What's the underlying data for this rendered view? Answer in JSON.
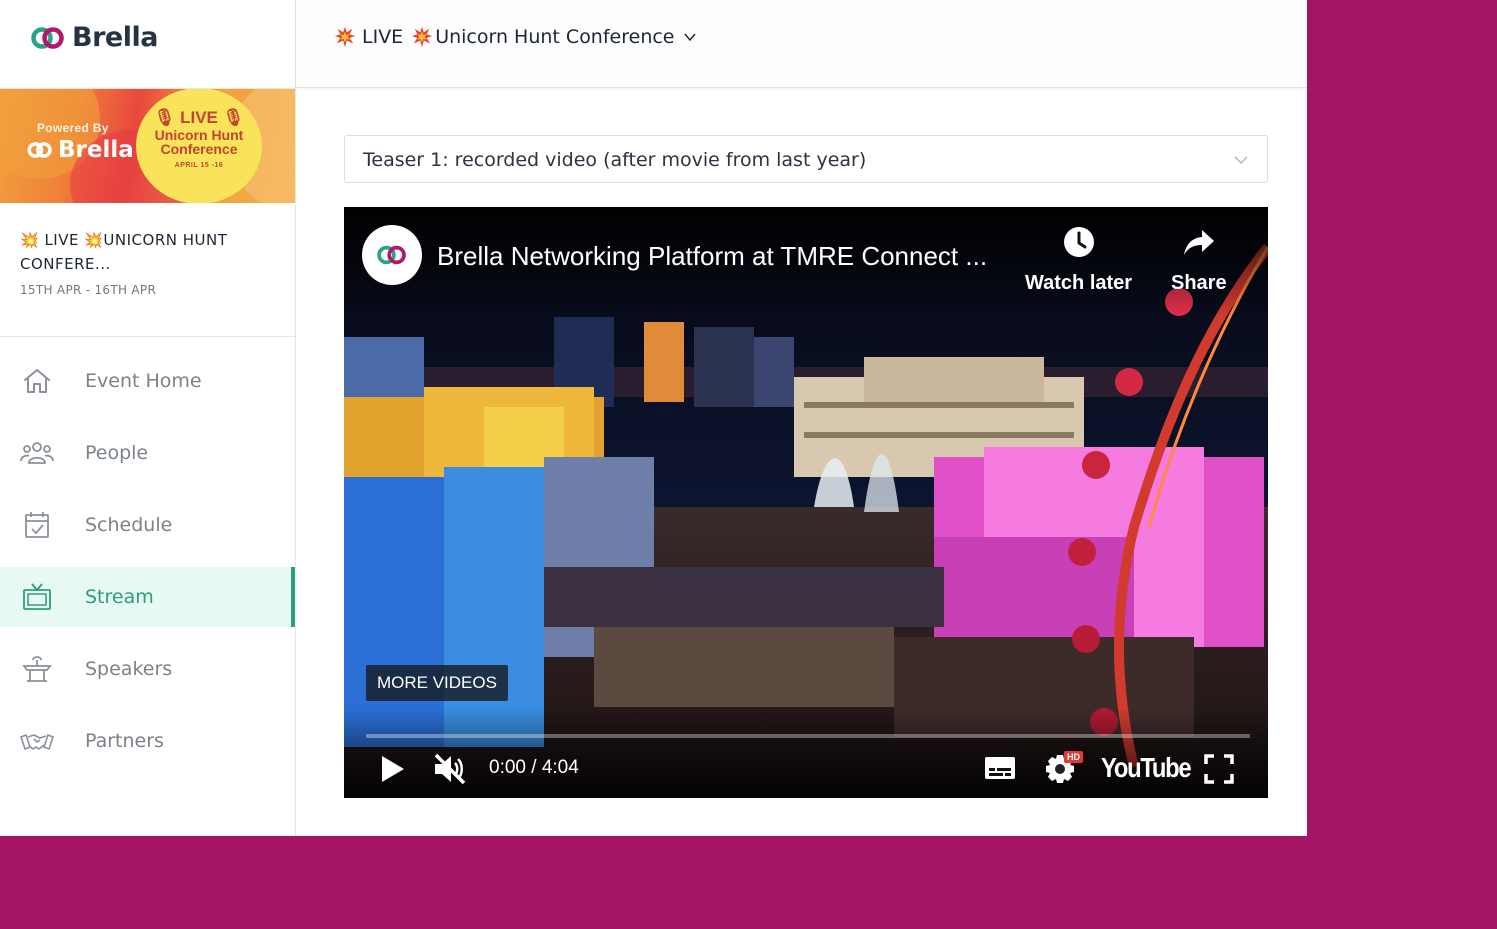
{
  "brand": {
    "name": "Brella",
    "accent_color": "#2a9e7f",
    "background_color": "#a31562"
  },
  "banner": {
    "powered_by": "Powered By",
    "brand": "Brella",
    "live": "LIVE",
    "name_line1": "Unicorn Hunt",
    "name_line2": "Conference",
    "date": "APRIL 15 -16"
  },
  "event": {
    "name": "💥 LIVE 💥UNICORN HUNT CONFERE...",
    "dates": "15TH APR - 16TH APR"
  },
  "header": {
    "live_label": "LIVE",
    "title": "Unicorn Hunt Conference"
  },
  "nav": {
    "items": [
      {
        "label": "Event Home",
        "icon": "home-icon",
        "active": false
      },
      {
        "label": "People",
        "icon": "people-icon",
        "active": false
      },
      {
        "label": "Schedule",
        "icon": "calendar-icon",
        "active": false
      },
      {
        "label": "Stream",
        "icon": "tv-icon",
        "active": true
      },
      {
        "label": "Speakers",
        "icon": "podium-icon",
        "active": false
      },
      {
        "label": "Partners",
        "icon": "handshake-icon",
        "active": false
      }
    ]
  },
  "stream_select": {
    "selected": "Teaser 1: recorded video (after movie from last year)"
  },
  "video": {
    "title": "Brella Networking Platform at TMRE Connect ...",
    "watch_later": "Watch later",
    "share": "Share",
    "more_videos": "MORE VIDEOS",
    "current_time": "0:00",
    "duration": "4:04",
    "time_display": "0:00 / 4:04",
    "hd_badge": "HD",
    "youtube_logo": "YouTube",
    "progress": 0
  }
}
